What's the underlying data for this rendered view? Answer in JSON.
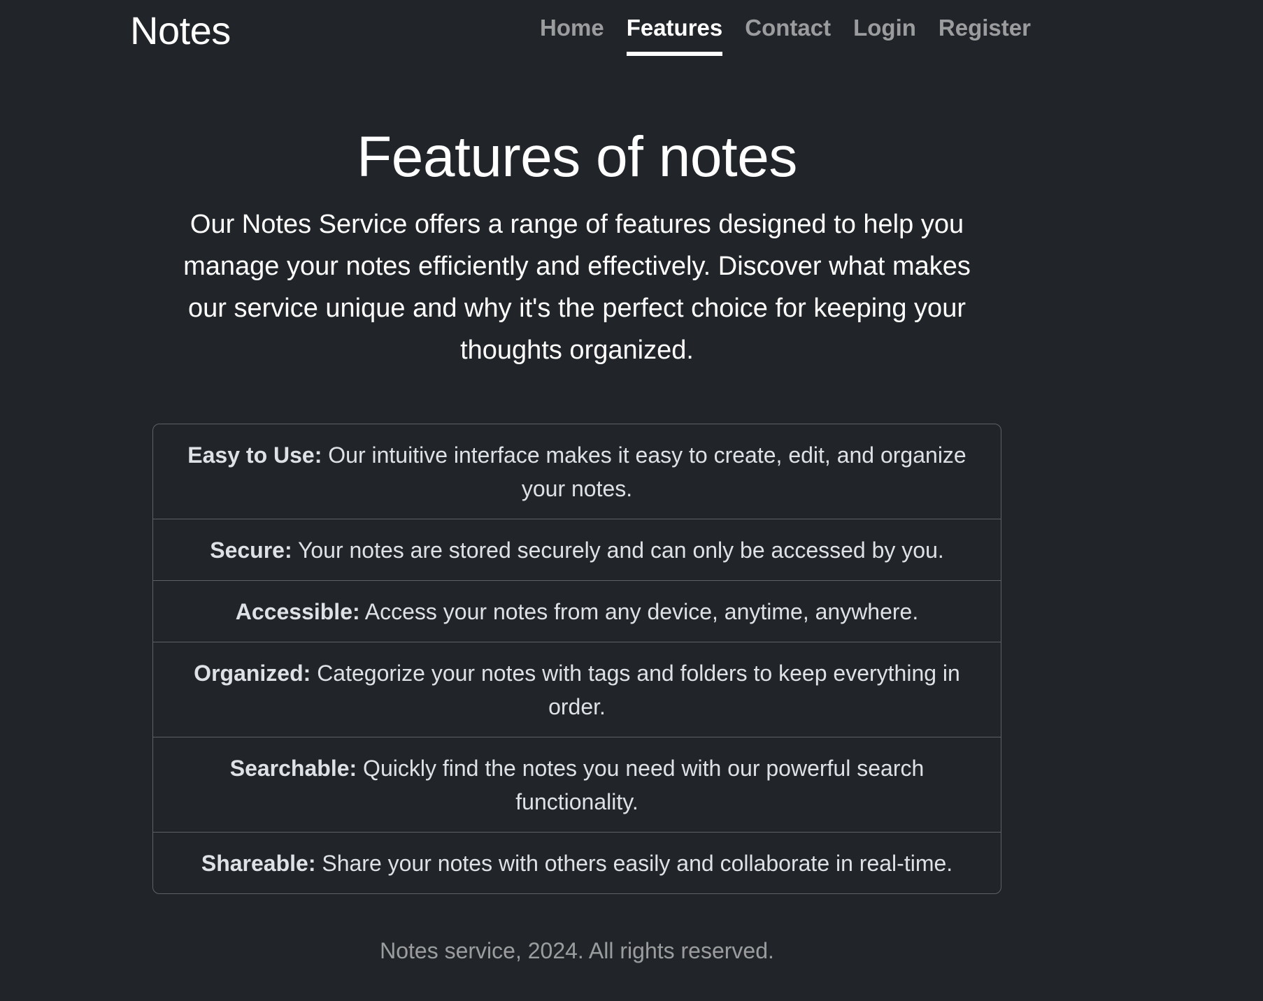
{
  "navbar": {
    "brand": "Notes",
    "links": [
      {
        "label": "Home",
        "active": false
      },
      {
        "label": "Features",
        "active": true
      },
      {
        "label": "Contact",
        "active": false
      },
      {
        "label": "Login",
        "active": false
      },
      {
        "label": "Register",
        "active": false
      }
    ]
  },
  "hero": {
    "title": "Features of notes",
    "lead": "Our Notes Service offers a range of features designed to help you manage your notes efficiently and effectively. Discover what makes our service unique and why it's the perfect choice for keeping your thoughts organized."
  },
  "features": [
    {
      "name": "Easy to Use:",
      "description": "Our intuitive interface makes it easy to create, edit, and organize your notes."
    },
    {
      "name": "Secure:",
      "description": "Your notes are stored securely and can only be accessed by you."
    },
    {
      "name": "Accessible:",
      "description": "Access your notes from any device, anytime, anywhere."
    },
    {
      "name": "Organized:",
      "description": "Categorize your notes with tags and folders to keep everything in order."
    },
    {
      "name": "Searchable:",
      "description": "Quickly find the notes you need with our powerful search functionality."
    },
    {
      "name": "Shareable:",
      "description": "Share your notes with others easily and collaborate in real-time."
    }
  ],
  "footer": {
    "text": "Notes service, 2024. All rights reserved."
  },
  "colors": {
    "background": "#212529",
    "text": "#ffffff",
    "muted_text": "#8b8d90",
    "border": "#5a5d61"
  }
}
